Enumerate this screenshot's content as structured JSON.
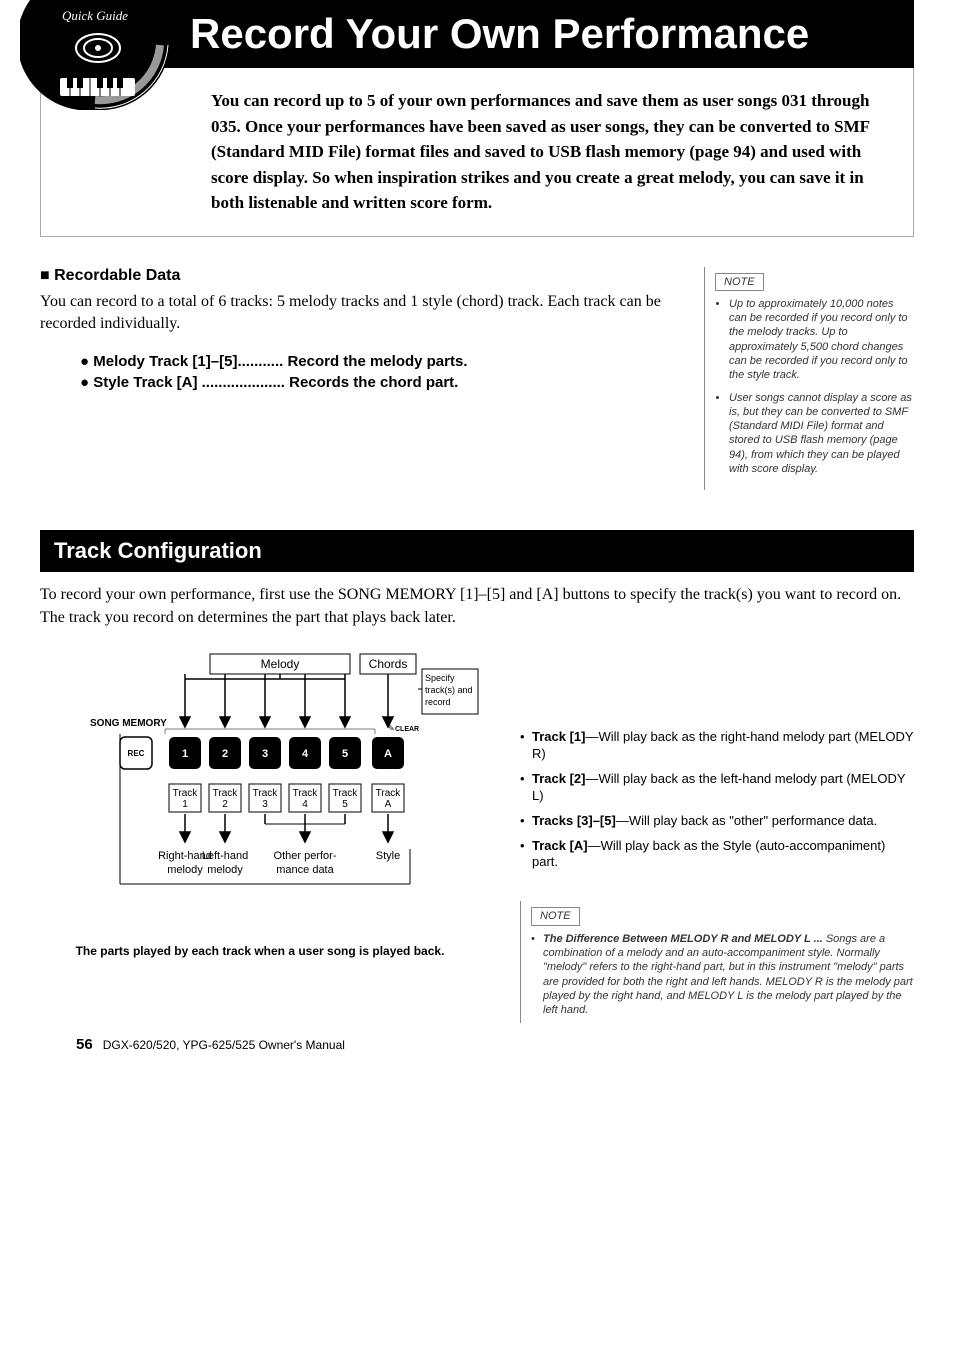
{
  "header": {
    "title": "Record Your Own Performance",
    "intro": "You can record up to 5 of your own performances and save them as user songs 031 through 035. Once your performances have been saved as user songs, they can be converted to SMF (Standard MID File) format files and saved to USB flash memory (page 94) and used with score display. So when inspiration strikes and you create a great melody, you can save it in both listenable and written score form.",
    "badge_top": "Quick Guide"
  },
  "recordable": {
    "heading": "■ Recordable Data",
    "body": "You can record to a total of 6 tracks: 5 melody tracks and 1 style (chord) track. Each track can be recorded individually.",
    "bullets": [
      "● Melody Track [1]–[5]........... Record the melody parts.",
      "● Style Track [A] .................... Records the chord part."
    ]
  },
  "note1": {
    "label": "NOTE",
    "items": [
      "Up to approximately 10,000 notes can be recorded if you record only to the melody tracks. Up to approximately 5,500 chord changes can be recorded if you record only to the style track.",
      "User songs cannot display a score as is, but they can be converted to SMF (Standard MIDI File) format and stored to USB flash memory (page 94), from which they can be played with score display."
    ]
  },
  "trackconfig": {
    "heading": "Track Configuration",
    "body": "To record your own performance, first use the SONG MEMORY [1]–[5] and [A] buttons to specify the track(s) you want to record on. The track you record on determines the part that plays back later."
  },
  "diagram": {
    "melody_label": "Melody",
    "chords_label": "Chords",
    "specify_label": "Specify track(s) and record",
    "song_memory": "SONG MEMORY",
    "clear": "CLEAR",
    "rec": "REC",
    "buttons": [
      "1",
      "2",
      "3",
      "4",
      "5",
      "A"
    ],
    "track_labels": [
      "Track 1",
      "Track 2",
      "Track 3",
      "Track 4",
      "Track 5",
      "Track A"
    ],
    "bottom_labels": [
      "Right-hand melody",
      "Left-hand melody",
      "Other performance data",
      "Style"
    ],
    "caption": "The parts played by each track when a user song is played back."
  },
  "tracklist": {
    "items": [
      {
        "b": "Track [1]",
        "t": "—Will play back as the right-hand melody part (MELODY R)"
      },
      {
        "b": "Track [2]",
        "t": "—Will play back as the left-hand melody part (MELODY L)"
      },
      {
        "b": "Tracks [3]–[5]",
        "t": "—Will play back as \"other\" performance data."
      },
      {
        "b": "Track [A]",
        "t": "—Will play back as the Style (auto-accompaniment) part."
      }
    ]
  },
  "note2": {
    "label": "NOTE",
    "lead": "The Difference Between MELODY R and MELODY L ...",
    "body": "Songs are a combination of a melody and an auto-accompaniment style. Normally \"melody\" refers to the right-hand part, but in this instrument \"melody\" parts are provided for both the right and left hands. MELODY R is the melody part played by the right hand, and MELODY L is the melody part played by the left hand."
  },
  "footer": {
    "page": "56",
    "manual": "DGX-620/520, YPG-625/525  Owner's Manual"
  }
}
